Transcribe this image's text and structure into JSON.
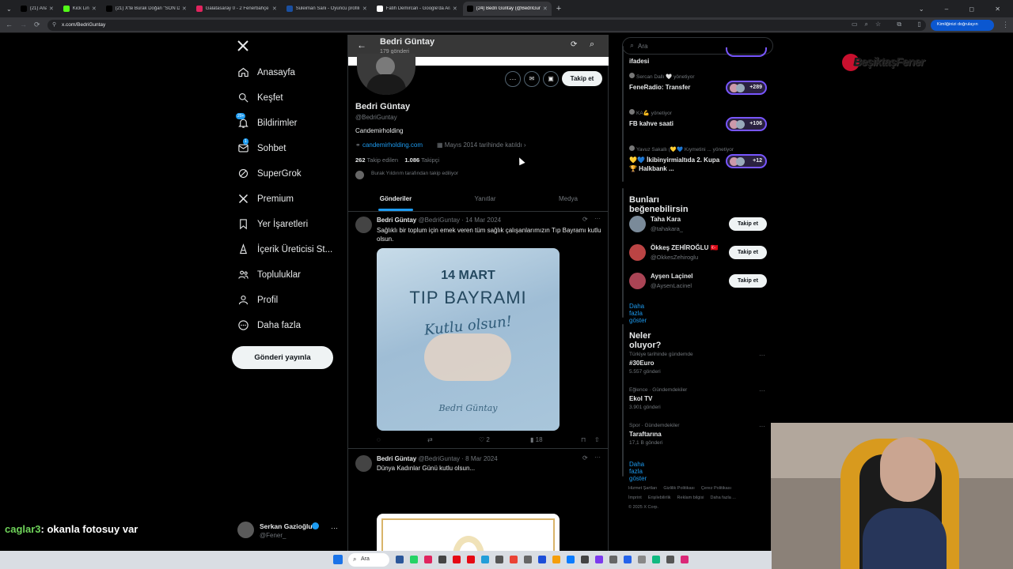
{
  "browser": {
    "tabs": [
      {
        "label": "(21) Ana",
        "color": "#000000"
      },
      {
        "label": "Kick Link",
        "color": "#53fc18"
      },
      {
        "label": "(21) X'te Burak Doğan \"SON D...",
        "color": "#000000"
      },
      {
        "label": "Galatasaray 0 - 2 Fenerbahçe H...",
        "color": "#e0245e"
      },
      {
        "label": "Suleiman Sani - Oyuncu profili",
        "color": "#1a4fa0"
      },
      {
        "label": "Fatih Demircan - Google'da Ara",
        "color": "#ffffff"
      },
      {
        "label": "(24) Bedri Güntay (@BedriGunt...",
        "color": "#000000"
      }
    ],
    "url": "x.com/BedriGuntay",
    "verify_label": "Kimliğinizi doğrulayın"
  },
  "sidebar": {
    "items": [
      {
        "label": "Anasayfa",
        "icon": "home-icon"
      },
      {
        "label": "Keşfet",
        "icon": "search-icon"
      },
      {
        "label": "Bildirimler",
        "icon": "bell-icon",
        "badge": "20+"
      },
      {
        "label": "Sohbet",
        "icon": "mail-icon",
        "badge": "1"
      },
      {
        "label": "SuperGrok",
        "icon": "grok-icon"
      },
      {
        "label": "Premium",
        "icon": "x-icon"
      },
      {
        "label": "Yer İşaretleri",
        "icon": "bookmark-icon"
      },
      {
        "label": "İçerik Üreticisi St...",
        "icon": "studio-icon"
      },
      {
        "label": "Topluluklar",
        "icon": "people-icon"
      },
      {
        "label": "Profil",
        "icon": "user-icon"
      },
      {
        "label": "Daha fazla",
        "icon": "more-icon"
      }
    ],
    "post_button": "Gönderi yayınla",
    "account": {
      "name": "Serkan Gazioğlu",
      "handle": "@Fener_"
    }
  },
  "profile": {
    "header_name": "Bedri Güntay",
    "header_sub": "179 gönderi",
    "name": "Bedri Güntay",
    "handle": "@BedriGuntay",
    "bio": "Candemirholding",
    "link": "candemirholding.com",
    "joined": "Mayıs 2014 tarihinde katıldı",
    "following_count": "262",
    "following_label": "Takip edilen",
    "followers_count": "1.086",
    "followers_label": "Takipçi",
    "followed_by": "Burak Yıldırım tarafından takip ediliyor",
    "follow_button": "Takip et",
    "tabs": [
      "Gönderiler",
      "Yanıtlar",
      "Medya"
    ]
  },
  "posts": [
    {
      "name": "Bedri Güntay",
      "meta": "@BedriGuntay · 14 Mar 2024",
      "text": "Sağlıklı bir toplum için emek veren tüm sağlık çalışanlarımızın Tıp Bayramı kutlu olsun.",
      "img_title1": "14 MART",
      "img_title2": "TIP BAYRAMI",
      "img_script": "Kutlu olsun!",
      "img_sign": "Bedri Güntay",
      "likes": "2",
      "views": "18"
    },
    {
      "name": "Bedri Güntay",
      "meta": "@BedriGuntay · 8 Mar 2024",
      "text": "Dünya Kadınlar Günü kutlu olsun..."
    }
  ],
  "right": {
    "search_placeholder": "Ara",
    "spaces": [
      {
        "host": "",
        "title": "ifadesi",
        "count": ""
      },
      {
        "host": "Sercan Dallı 🤍 yönetiyor",
        "title": "FeneRadio: Transfer",
        "count": "+289"
      },
      {
        "host": "KA💪 yönetiyor",
        "title": "FB kahve saati",
        "count": "+106"
      },
      {
        "host": "Yavuz Sakallı (💛💙 Kıymetini ... yönetiyor",
        "title": "💛💙 İkibinyirmialtıda 2. Kupa🏆 Halkbank ...",
        "count": "+12"
      }
    ],
    "wtf_title": "Bunları beğenebilirsin",
    "wtf": [
      {
        "name": "Taha Kara",
        "handle": "@tahakara_"
      },
      {
        "name": "Ökkeş ZEHİROĞLU 🇹🇷",
        "handle": "@OkkesZehiroglu"
      },
      {
        "name": "Ayşen Laçinel",
        "handle": "@AysenLacinel"
      }
    ],
    "follow_label": "Takip et",
    "show_more": "Daha fazla göster",
    "trends_title": "Neler oluyor?",
    "trends": [
      {
        "context": "Türkiye tarihinde gündemde",
        "name": "#30Euro",
        "count": "5.557 gönderi"
      },
      {
        "context": "Eğlence · Gündemdekiler",
        "name": "Ekol TV",
        "count": "3.901 gönderi"
      },
      {
        "context": "Spor · Gündemdekiler",
        "name": "Taraftarına",
        "count": "17,1 B gönderi"
      }
    ],
    "footer": [
      "Hizmet Şartları",
      "Gizlilik Politikası",
      "Çerez Politikası",
      "İmprint",
      "Erişilebilirlik",
      "Reklam bilgisi",
      "Daha fazla ...",
      "© 2025 X Corp."
    ]
  },
  "overlay": {
    "chat_user": "caglar3",
    "chat_text": ": okanla fotosuy var",
    "logo_text": "BeşiktaşFener"
  },
  "taskbar": {
    "search": "Ara"
  }
}
